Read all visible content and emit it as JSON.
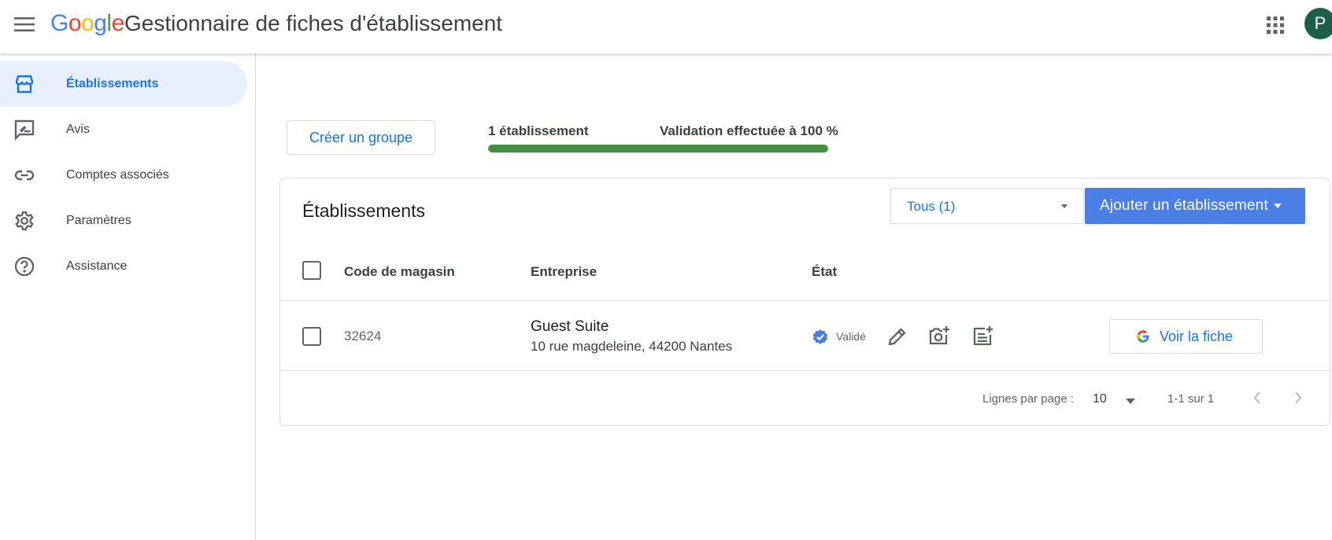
{
  "header": {
    "logo": [
      "G",
      "o",
      "o",
      "g",
      "l",
      "e"
    ],
    "logo_colors": [
      "#4285F4",
      "#EA4335",
      "#FBBC05",
      "#4285F4",
      "#34A853",
      "#EA4335"
    ],
    "title": "Gestionnaire de fiches d'établissement",
    "avatar_letter": "P",
    "avatar_color": "#1b5e4a"
  },
  "sidebar": {
    "items": [
      {
        "label": "Établissements",
        "icon": "storefront-icon",
        "active": true
      },
      {
        "label": "Avis",
        "icon": "review-icon",
        "active": false
      },
      {
        "label": "Comptes associés",
        "icon": "link-icon",
        "active": false
      },
      {
        "label": "Paramètres",
        "icon": "gear-icon",
        "active": false
      },
      {
        "label": "Assistance",
        "icon": "help-icon",
        "active": false
      }
    ]
  },
  "toolbar": {
    "create_group_label": "Créer un groupe",
    "count_label": "1 établissement",
    "validation_label": "Validation effectuée à 100 %",
    "validation_progress": 1.0,
    "progress_color": "#3f9142"
  },
  "card": {
    "title": "Établissements",
    "filter_value": "Tous (1)",
    "add_button_label": "Ajouter un établissement",
    "columns": [
      "Code de magasin",
      "Entreprise",
      "État"
    ],
    "rows": [
      {
        "code": "32624",
        "name": "Guest Suite",
        "address": "10 rue magdeleine, 44200 Nantes",
        "status": "Validé",
        "view_label": "Voir la fiche"
      }
    ],
    "footer": {
      "rows_per_page_label": "Lignes par page :",
      "rows_per_page_value": "10",
      "range_label": "1-1 sur 1"
    }
  },
  "colors": {
    "accent": "#1a73e8",
    "primary_button": "#4b7fe6",
    "active_nav_bg": "#e8f0fe",
    "verified": "#4a7fe0"
  }
}
